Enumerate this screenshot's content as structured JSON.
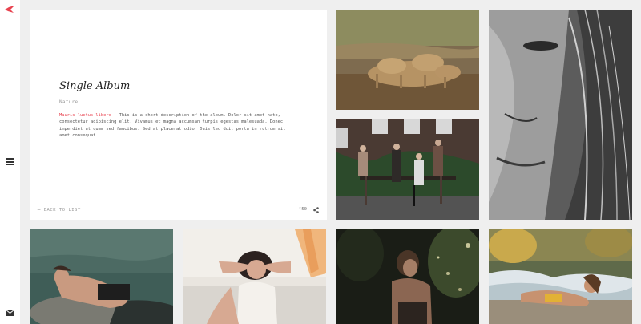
{
  "sidebar": {
    "logo_icon": "bird-logo-icon",
    "menu_icon": "hamburger-menu-icon",
    "contact_icon": "envelope-icon",
    "accent_color": "#e8424f"
  },
  "album": {
    "title": "Single Album",
    "category": "Nature",
    "description_highlight": "Mauris luctus libero",
    "description_rest": " - This is a short description of the album. Dolor sit amet nate, consectetur adipiscing elit. Vivamus et magna accumsan turpis egestas malesuada. Donec imperdiet ut quam sed faucibus. Sed at placerat odio. Duis leo dui, porta in rutrum sit amet consequat.",
    "back_label": "BACK TO LIST",
    "likes": "50",
    "like_icon": "heart-icon",
    "share_icon": "share-icon"
  },
  "photos": [
    {
      "subject": "lions"
    },
    {
      "subject": "woman-face-closeup"
    },
    {
      "subject": "group-on-bench"
    },
    {
      "subject": "woman-on-rock"
    },
    {
      "subject": "woman-in-bath"
    },
    {
      "subject": "woman-in-dark-forest"
    },
    {
      "subject": "woman-on-beach"
    }
  ]
}
